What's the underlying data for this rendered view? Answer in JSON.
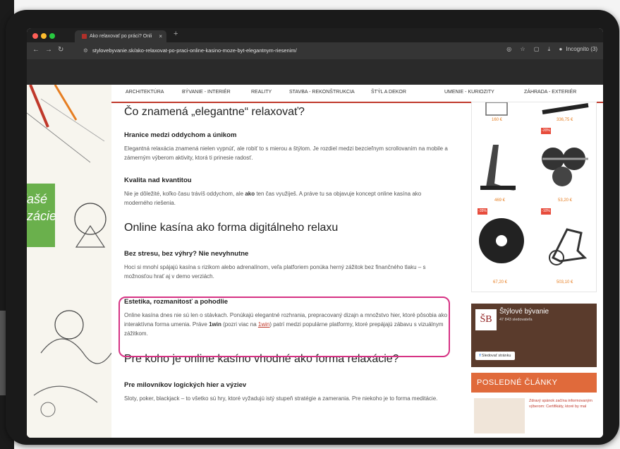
{
  "browser": {
    "tab_title": "Ako relaxovať po práci? Onli",
    "tab_close": "×",
    "new_tab": "+",
    "url": "stylovebyvanie.sk/ako-relaxovat-po-praci-online-kasino-moze-byt-elegantnym-riesenim/",
    "incognito_label": "Incognito (3)"
  },
  "menu": {
    "items": [
      "ARCHITEKTÚRA",
      "BÝVANIE - INTERIÉR",
      "REALITY",
      "STAVBA - REKONŠTRUKCIA",
      "ŠTÝL A DEKOR",
      "UMENIE - KURIOZITY",
      "ZÁHRADA - EXTERIÉR"
    ]
  },
  "left_banner": {
    "line1": "lašé",
    "line2": "izácie"
  },
  "article": {
    "h1": "Čo znamená „elegantne“ relaxovať?",
    "s1_title": "Hranice medzi oddychom a únikom",
    "s1_text": "Elegantná relaxácia znamená nielen vypnúť, ale robiť to s mierou a štýlom. Je rozdiel medzi bezcieľnym scrollovaním na mobile a zámerným výberom aktivity, ktorá ti prinesie radosť.",
    "s2_title": "Kvalita nad kvantitou",
    "s2_text_a": "Nie je dôležité, koľko času trávíš oddychom, ale ",
    "s2_text_b": "ako",
    "s2_text_c": " ten čas využiješ. A práve tu sa objavuje koncept online kasína ako moderného riešenia.",
    "h2": "Online kasína ako forma digitálneho relaxu",
    "s3_title": "Bez stresu, bez výhry? Nie nevyhnutne",
    "s3_text": "Hoci si mnohí spájajú kasína s rizikom alebo adrenalínom, veľa platforiem ponúka herný zážitok bez finančného tlaku – s možnosťou hrať aj v demo verziách.",
    "s4_title": "Estetika, rozmanitosť a pohodlie",
    "s4_text_a": "Online kasína dnes nie sú len o stávkach. Ponúkajú elegantné rozhrania, prepracovaný dizajn a množstvo hier, ktoré pôsobia ako interaktívna forma umenia. Práve ",
    "s4_text_b": "1win",
    "s4_text_c": " (pozri viac na ",
    "s4_link": "1win",
    "s4_text_d": ") patrí medzi populárne platformy, ktoré prepájajú zábavu s vizuálnym zážitkom.",
    "h3": "Pre koho je online kasíno vhodné ako forma relaxácie?",
    "s5_title": "Pre milovníkov logických hier a výziev",
    "s5_text": "Sloty, poker, blackjack – to všetko sú hry, ktoré vyžadujú istý stupeň stratégie a zamerania. Pre niekoho je to forma meditácie."
  },
  "sidebar": {
    "prices": [
      "160 €",
      "336,75 €",
      "469 €",
      "53,20 €",
      "67,20 €",
      "503,10 €"
    ],
    "discounts": [
      "-20%",
      "-35%",
      "-10%"
    ],
    "fb_page_name": "Štýlové bývanie",
    "fb_followers": "47 843 sledovateľa",
    "fb_follow_button": "Sledovať stránku",
    "fb_logo": "ŠB",
    "recent_title": "POSLEDNÉ ČLÁNKY",
    "recent_text": "Zdravý spánok začína informovaným výberom: Certifikáty, ktoré by mal"
  }
}
